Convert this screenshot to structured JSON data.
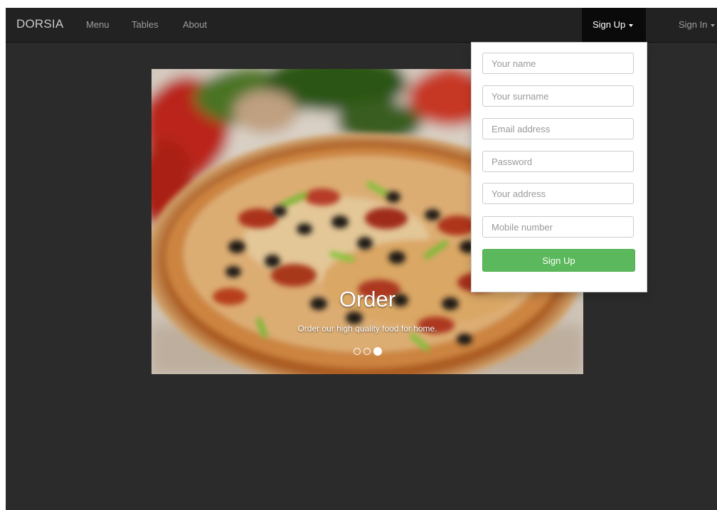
{
  "navbar": {
    "brand": "DORSIA",
    "links": [
      "Menu",
      "Tables",
      "About"
    ],
    "signup_label": "Sign Up",
    "signin_label": "Sign In"
  },
  "carousel": {
    "title": "Order",
    "subtitle": "Order our high quality food for home.",
    "indicator_count": 3,
    "active_indicator": 3
  },
  "signup_form": {
    "name_placeholder": "Your name",
    "surname_placeholder": "Your surname",
    "email_placeholder": "Email address",
    "password_placeholder": "Password",
    "address_placeholder": "Your address",
    "mobile_placeholder": "Mobile number",
    "submit_label": "Sign Up"
  },
  "colors": {
    "navbar_bg": "#222222",
    "page_bg": "#2b2b2b",
    "active_nav_bg": "#0a0a0a",
    "button_green": "#5cb85c"
  },
  "icons": {
    "dropdown_caret": "caret-down-icon"
  }
}
